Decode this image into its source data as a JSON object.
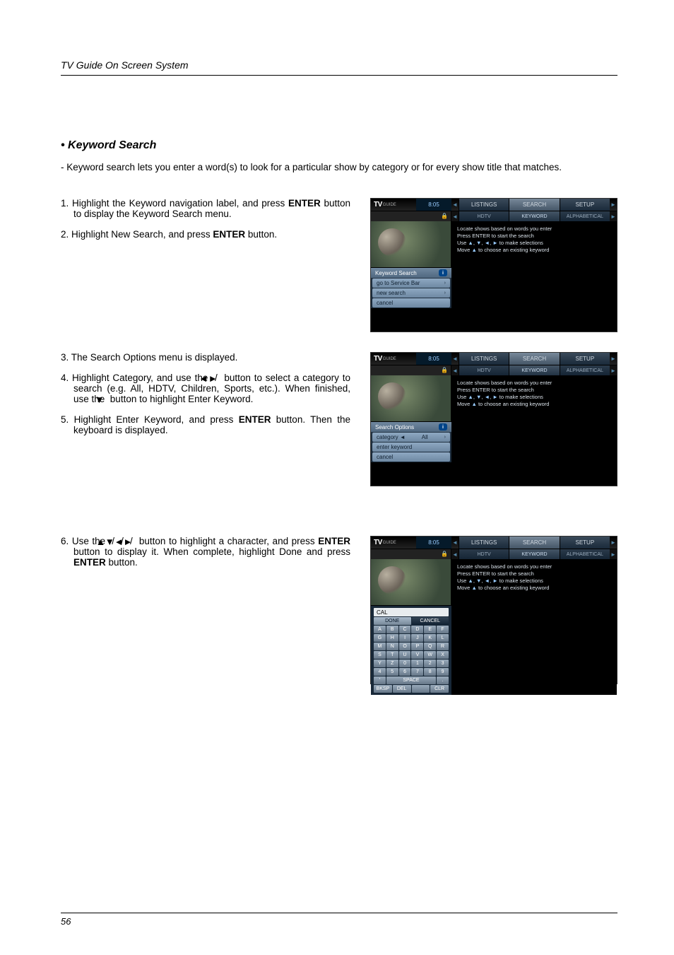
{
  "header": {
    "running": "TV Guide On Screen System"
  },
  "section": {
    "title_prefix": "• ",
    "title": "Keyword Search"
  },
  "intro": {
    "text": "- Keyword search lets you enter a word(s) to look for a particular show by category or for every show title that matches."
  },
  "steps": {
    "s1a": "1. Highlight the Keyword navigation label, and press ",
    "s1b": " button to display the Keyword Search menu.",
    "s2a": "2. Highlight New Search, and press ",
    "s2b": " button.",
    "s3": "3. The Search Options menu is displayed.",
    "s4a": "4. Highlight Category, and use the ",
    "s4b": " button to select a category to search (e.g. All, HDTV, Children, Sports, etc.). When finished, use the ",
    "s4c": " button to highlight Enter Keyword.",
    "s5a": "5. Highlight Enter Keyword, and press ",
    "s5b": " button. Then the keyboard is displayed.",
    "s6a": "6. Use the ",
    "s6b": " button to highlight a character, and press ",
    "s6c": " button to display it. When complete, highlight Done and press ",
    "s6d": " button."
  },
  "bold": {
    "enter": "ENTER"
  },
  "arrows": {
    "left": "◄",
    "right": "►",
    "up": "▲",
    "down": "▼",
    "slash": " / "
  },
  "tv": {
    "logo": "TV",
    "logo_sub": "GUIDE",
    "time": "8:05",
    "tabs": {
      "listings": "LISTINGS",
      "search": "SEARCH",
      "setup": "SETUP"
    },
    "subtabs": {
      "hdtv": "HDTV",
      "keyword": "KEYWORD",
      "alpha": "ALPHABETICAL"
    },
    "info": {
      "l1": "Locate shows based on words you enter",
      "l2": "Press ENTER to start the search",
      "l3a": "Use ",
      "l3b": " to make selections",
      "l4a": "Move ",
      "l4b": " to choose an existing keyword"
    },
    "panel1": {
      "title": "Keyword Search",
      "i1": "go to Service Bar",
      "i2": "new search",
      "i3": "cancel"
    },
    "panel2": {
      "title": "Search Options",
      "cat_label": "category ◄",
      "cat_val": "All",
      "i2": "enter keyword",
      "i3": "cancel"
    },
    "panel3": {
      "input": "CAL",
      "done": "DONE",
      "cancel": "CANCEL",
      "row1": [
        "A",
        "B",
        "C",
        "D",
        "E",
        "F"
      ],
      "row2": [
        "G",
        "H",
        "I",
        "J",
        "K",
        "L"
      ],
      "row3": [
        "M",
        "N",
        "O",
        "P",
        "Q",
        "R"
      ],
      "row4": [
        "S",
        "T",
        "U",
        "V",
        "W",
        "X"
      ],
      "row5": [
        "Y",
        "Z",
        "0",
        "1",
        "2",
        "3"
      ],
      "row6": [
        "4",
        "5",
        "6",
        "7",
        "8",
        "9"
      ],
      "row7a": "'",
      "row7b": "SPACE",
      "row7c": ".",
      "row8": [
        "BKSP",
        "DEL",
        "",
        "CLR"
      ]
    },
    "info_icon": "i",
    "lock": "🔒",
    "arrow_l": "◄",
    "arrow_r": "►",
    "chev": "›"
  },
  "footer": {
    "page": "56"
  }
}
